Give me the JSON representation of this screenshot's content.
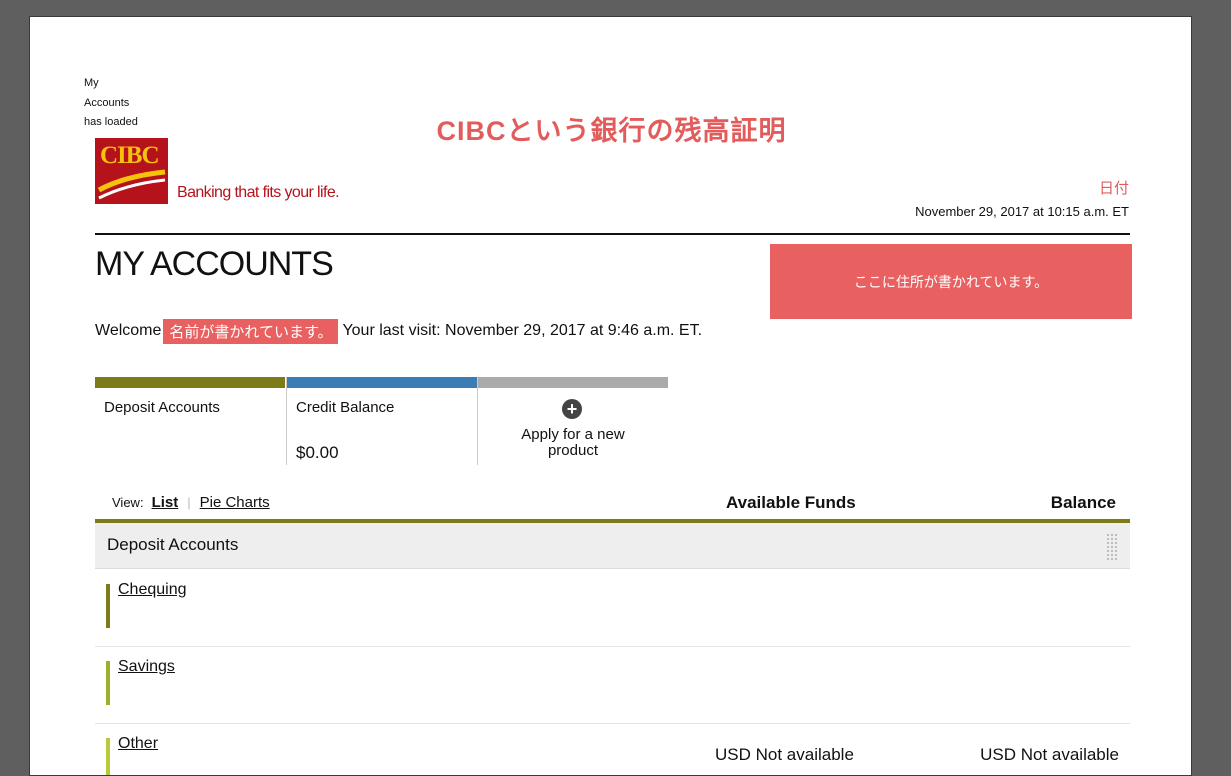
{
  "screen_reader_note": "My Accounts has loaded",
  "annotation_title": "CIBCという銀行の残高証明",
  "brand": {
    "logo_text": "CIBC",
    "tagline": "Banking that fits your life."
  },
  "date_annotation": "日付",
  "timestamp": "November 29, 2017 at 10:15 a.m. ET",
  "page_title": "MY ACCOUNTS",
  "address_annotation": "ここに住所が書かれています。",
  "welcome": {
    "prefix": "Welcome",
    "name_annotation": "名前が書かれています。",
    "last_visit": "Your last visit: November 29, 2017 at 9:46 a.m. ET."
  },
  "tiles": [
    {
      "label": "Deposit Accounts",
      "value": "",
      "color": "#7d7a1a"
    },
    {
      "label": "Credit Balance",
      "value": "$0.00",
      "color": "#3a7db4"
    },
    {
      "label": "Apply for a new product",
      "icon": "plus-circle-icon",
      "color": "#aaaaaa"
    }
  ],
  "view": {
    "label": "View:",
    "list": "List",
    "pie": "Pie Charts"
  },
  "columns": {
    "funds": "Available Funds",
    "balance": "Balance"
  },
  "group": {
    "label": "Deposit Accounts"
  },
  "accounts": [
    {
      "name": "Chequing",
      "funds": "",
      "balance": "",
      "color": "#7d7a1a"
    },
    {
      "name": "Savings",
      "funds": "",
      "balance": "",
      "color": "#9cb02e"
    },
    {
      "name": "Other",
      "funds": "USD Not available",
      "balance": "USD Not available",
      "color": "#b8c93a"
    }
  ]
}
